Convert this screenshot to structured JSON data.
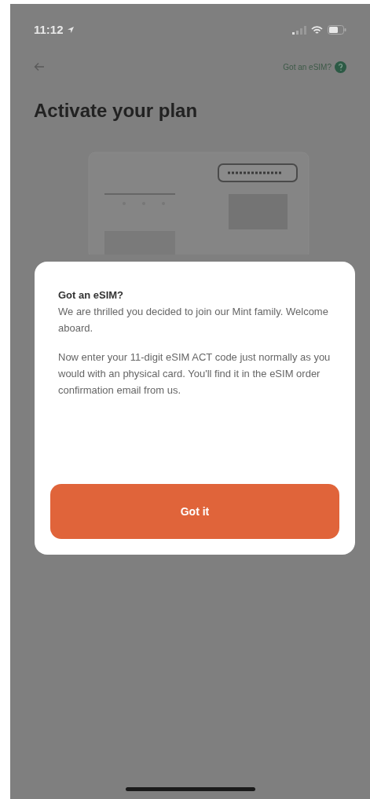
{
  "status_bar": {
    "time": "11:12"
  },
  "header": {
    "link": "Got an eSIM?"
  },
  "title": "Activate your plan",
  "dialog": {
    "title": "Got an eSIM?",
    "paragraphs": [
      "We are thrilled you decided to join our Mint family. Welcome aboard.",
      "Now enter your 11-digit eSIM ACT code just normally as you would with an physical card. You'll find it in the eSIM order confirmation email from us."
    ],
    "button": "Got it"
  }
}
